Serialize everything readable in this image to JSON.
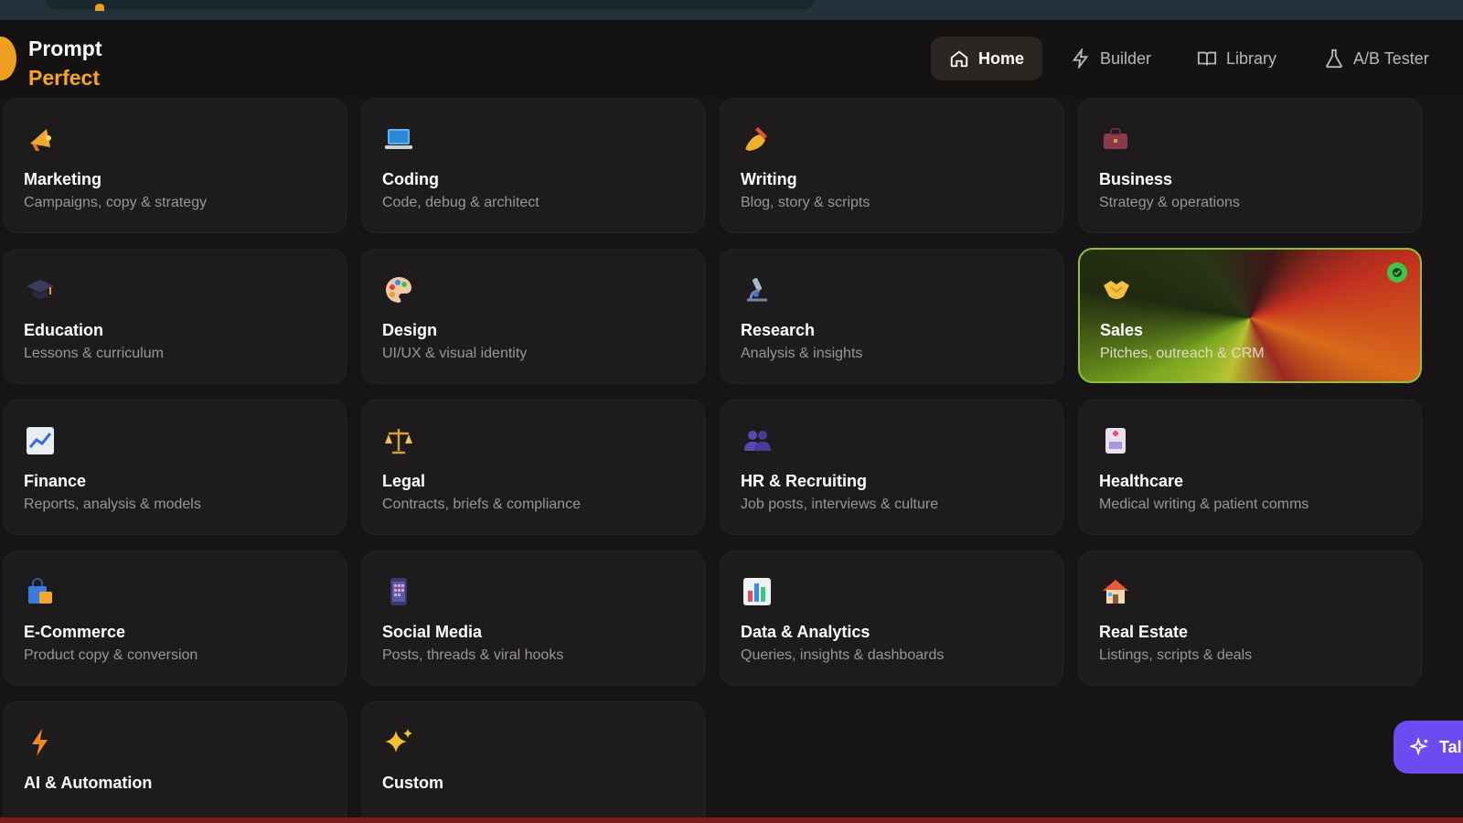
{
  "brand": {
    "line1": "Prompt",
    "line2": "Perfect"
  },
  "nav": [
    {
      "label": "Home",
      "icon": "home-icon",
      "active": true
    },
    {
      "label": "Builder",
      "icon": "bolt-icon",
      "active": false
    },
    {
      "label": "Library",
      "icon": "book-icon",
      "active": false
    },
    {
      "label": "A/B Tester",
      "icon": "flask-icon",
      "active": false
    }
  ],
  "categories": [
    {
      "title": "Marketing",
      "sub": "Campaigns, copy & strategy",
      "icon": "megaphone-icon"
    },
    {
      "title": "Coding",
      "sub": "Code, debug & architect",
      "icon": "laptop-icon"
    },
    {
      "title": "Writing",
      "sub": "Blog, story & scripts",
      "icon": "writing-hand-icon"
    },
    {
      "title": "Business",
      "sub": "Strategy & operations",
      "icon": "briefcase-icon"
    },
    {
      "title": "Education",
      "sub": "Lessons & curriculum",
      "icon": "graduation-cap-icon"
    },
    {
      "title": "Design",
      "sub": "UI/UX & visual identity",
      "icon": "palette-icon"
    },
    {
      "title": "Research",
      "sub": "Analysis & insights",
      "icon": "microscope-icon"
    },
    {
      "title": "Sales",
      "sub": "Pitches, outreach & CRM",
      "icon": "handshake-icon",
      "selected": true
    },
    {
      "title": "Finance",
      "sub": "Reports, analysis & models",
      "icon": "chart-up-icon"
    },
    {
      "title": "Legal",
      "sub": "Contracts, briefs & compliance",
      "icon": "scales-icon"
    },
    {
      "title": "HR & Recruiting",
      "sub": "Job posts, interviews & culture",
      "icon": "people-icon"
    },
    {
      "title": "Healthcare",
      "sub": "Medical writing & patient comms",
      "icon": "medical-icon"
    },
    {
      "title": "E-Commerce",
      "sub": "Product copy & conversion",
      "icon": "shopping-bag-icon"
    },
    {
      "title": "Social Media",
      "sub": "Posts, threads & viral hooks",
      "icon": "phone-icon"
    },
    {
      "title": "Data & Analytics",
      "sub": "Queries, insights & dashboards",
      "icon": "bar-chart-icon"
    },
    {
      "title": "Real Estate",
      "sub": "Listings, scripts & deals",
      "icon": "house-icon"
    },
    {
      "title": "AI & Automation",
      "sub": "",
      "icon": "lightning-icon"
    },
    {
      "title": "Custom",
      "sub": "",
      "icon": "sparkles-icon"
    }
  ],
  "float_button": {
    "label": "Tal",
    "icon": "sparkle-icon"
  },
  "colors": {
    "accent": "#f5a623",
    "selected_border": "#8fc23a",
    "float": "#6a4cf0"
  }
}
